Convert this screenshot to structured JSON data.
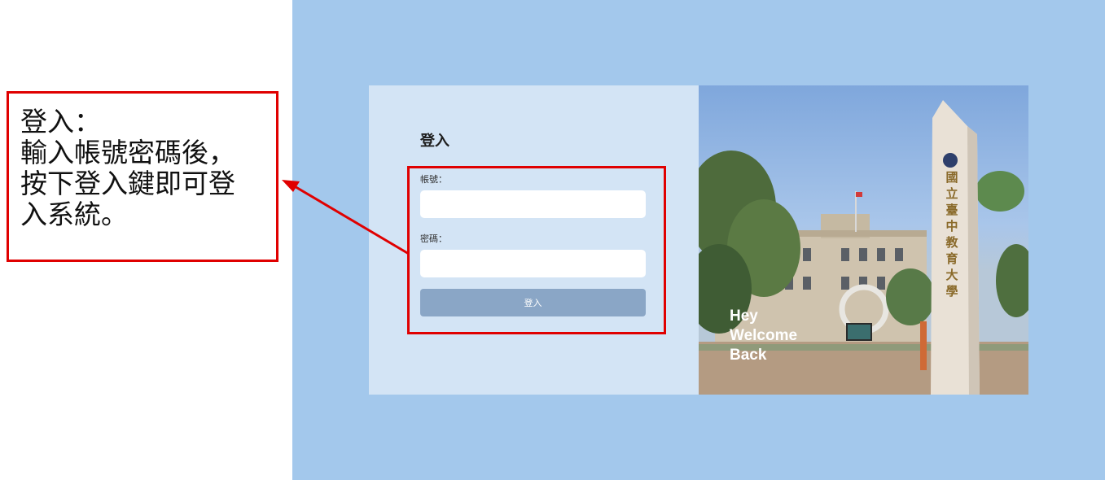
{
  "annotation": {
    "lines": [
      "登入：",
      "輸入帳號密碼後，",
      "按下登入鍵即可登",
      "入系統。"
    ]
  },
  "login": {
    "title": "登入",
    "username_label": "帳號：",
    "username_value": "",
    "password_label": "密碼：",
    "password_value": "",
    "submit_label": "登入"
  },
  "welcome": {
    "lines": [
      "Hey",
      "Welcome",
      "Back"
    ]
  },
  "monument": {
    "chars": [
      "國",
      "立",
      "臺",
      "中",
      "教",
      "育",
      "大",
      "學"
    ]
  },
  "colors": {
    "background": "#a3c8ec",
    "form_panel": "#d3e4f5",
    "button": "#8aa6c6",
    "annotation": "#e00000"
  }
}
